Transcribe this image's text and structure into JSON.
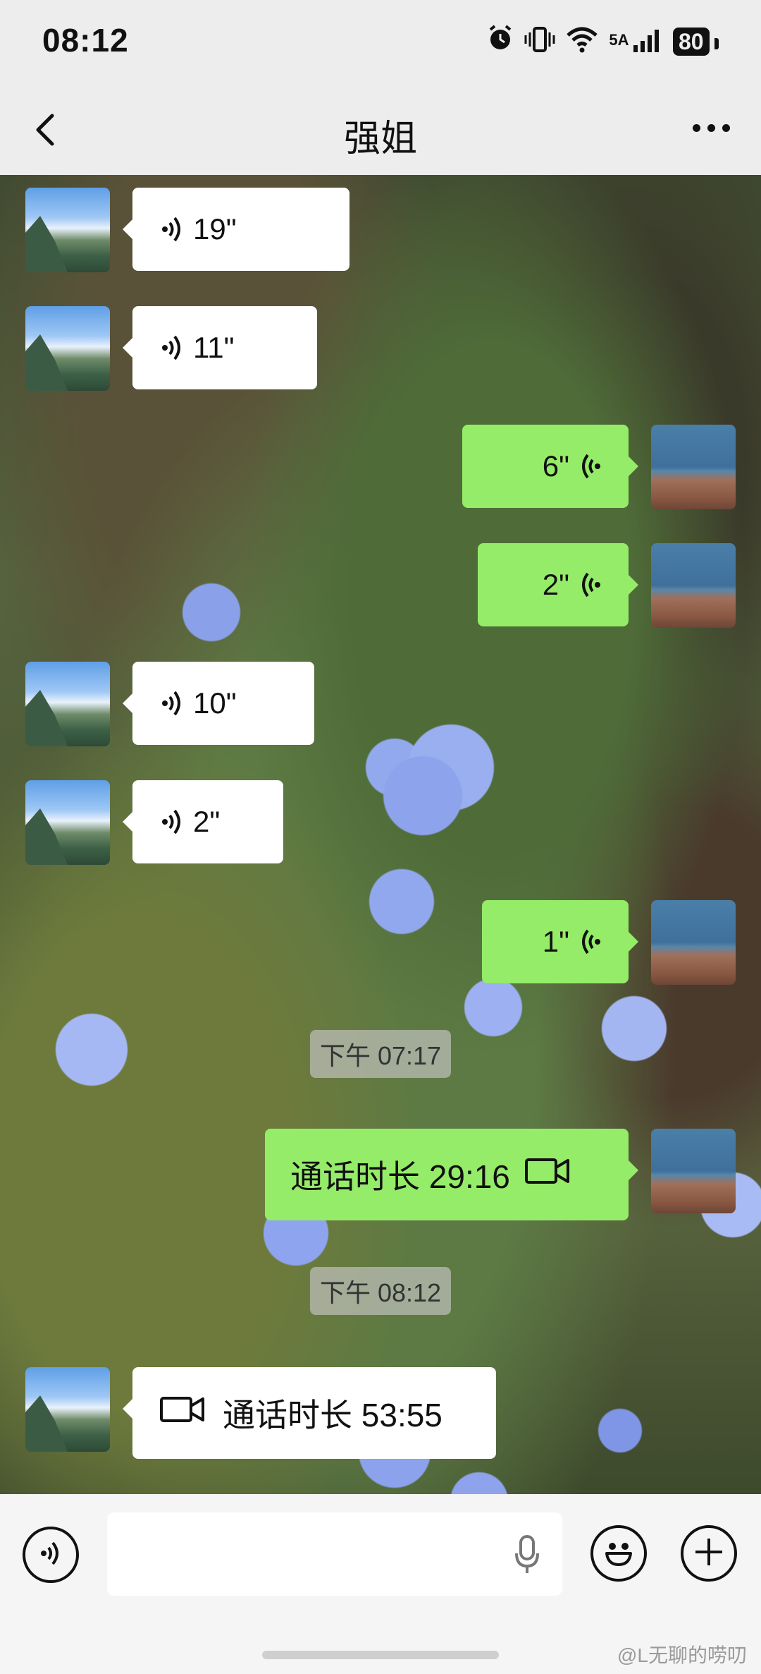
{
  "status_bar": {
    "time": "08:12",
    "network": "5A",
    "battery": "80"
  },
  "header": {
    "title": "强姐"
  },
  "messages": [
    {
      "side": "in",
      "kind": "voice",
      "duration": "19\""
    },
    {
      "side": "in",
      "kind": "voice",
      "duration": "11\""
    },
    {
      "side": "out",
      "kind": "voice",
      "duration": "6\""
    },
    {
      "side": "out",
      "kind": "voice",
      "duration": "2\""
    },
    {
      "side": "in",
      "kind": "voice",
      "duration": "10\""
    },
    {
      "side": "in",
      "kind": "voice",
      "duration": "2\""
    },
    {
      "side": "out",
      "kind": "voice",
      "duration": "1\""
    },
    {
      "kind": "timestamp",
      "text": "下午 07:17"
    },
    {
      "side": "out",
      "kind": "video-call",
      "text": "通话时长 29:16"
    },
    {
      "kind": "timestamp",
      "text": "下午 08:12"
    },
    {
      "side": "in",
      "kind": "video-call",
      "text": "通话时长 53:55"
    }
  ],
  "input": {
    "value": ""
  },
  "watermark": "@L无聊的唠叨",
  "colors": {
    "out_bubble": "#95ec69",
    "in_bubble": "#ffffff",
    "background": "#ededed"
  },
  "icons": [
    "alarm-icon",
    "vibrate-icon",
    "wifi-icon",
    "signal-icon",
    "battery-icon",
    "back-icon",
    "more-icon",
    "voice-wave-icon",
    "video-camera-icon",
    "voice-mode-icon",
    "microphone-icon",
    "emoji-icon",
    "plus-icon"
  ]
}
